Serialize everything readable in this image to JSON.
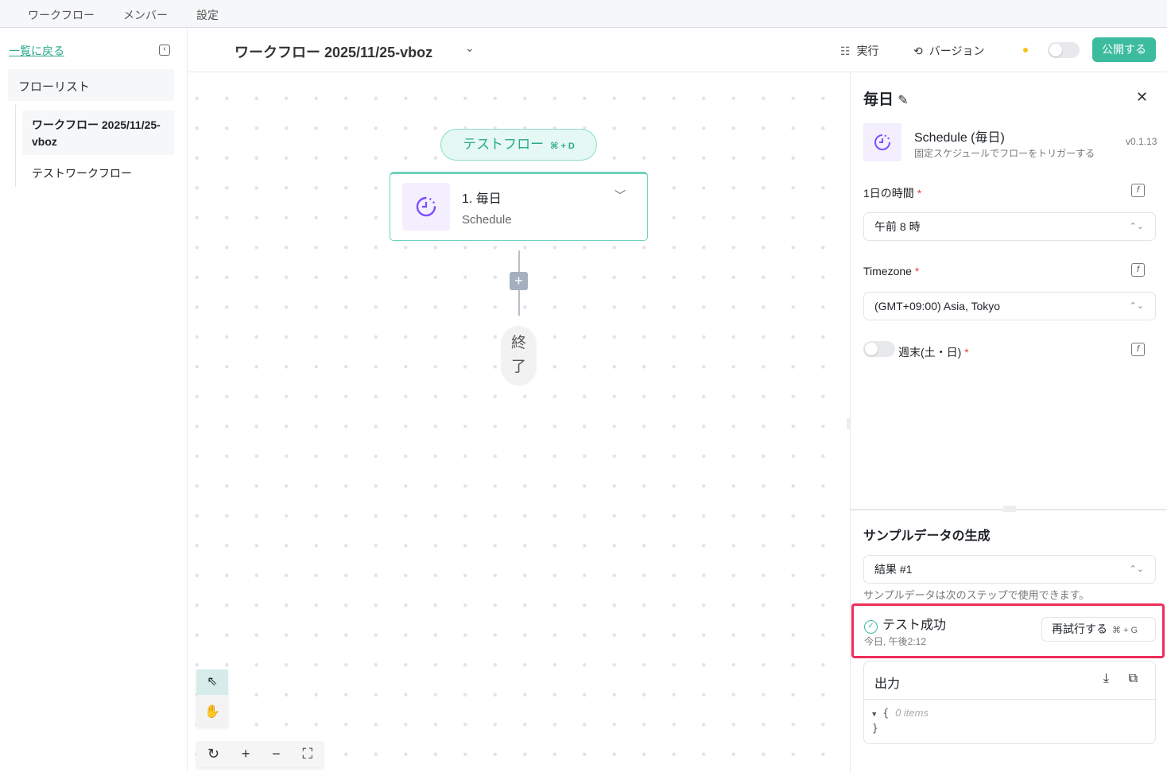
{
  "topnav": {
    "items": [
      "ワークフロー",
      "メンバー",
      "設定"
    ]
  },
  "sidebar": {
    "back": "一覧に戻る",
    "flow_list": "フローリスト",
    "items": [
      "ワークフロー 2025/11/25-vboz",
      "テストワークフロー"
    ]
  },
  "header": {
    "title": "ワークフロー 2025/11/25-vboz",
    "run": "実行",
    "version": "バージョン",
    "publish": "公開する"
  },
  "canvas": {
    "test_flow": "テストフロー",
    "test_flow_shortcut": "⌘ + D",
    "node": {
      "name": "1. 毎日",
      "type": "Schedule"
    },
    "end": [
      "終",
      "了"
    ]
  },
  "panel": {
    "title": "毎日",
    "app_name": "Schedule (毎日)",
    "app_desc": "固定スケジュールでフローをトリガーする",
    "version": "v0.1.13",
    "fields": [
      {
        "label": "1日の時間",
        "value": "午前 8 時"
      },
      {
        "label": "Timezone",
        "value": "(GMT+09:00) Asia, Tokyo"
      },
      {
        "label": "週末(土・日)"
      }
    ],
    "required_mark": "*",
    "sample": {
      "title": "サンプルデータの生成",
      "result": "結果 #1",
      "hint": "サンプルデータは次のステップで使用できます。",
      "status": "テスト成功",
      "time": "今日, 午後2:12",
      "retry": "再試行する",
      "retry_shortcut": "⌘ + G",
      "output_label": "出力",
      "output_open": "{",
      "output_items": "0 items",
      "output_close": "}"
    }
  },
  "colors": {
    "accent": "#3dbb9f",
    "highlight": "#ee2f5b",
    "icon_purple": "#7c4dff"
  }
}
